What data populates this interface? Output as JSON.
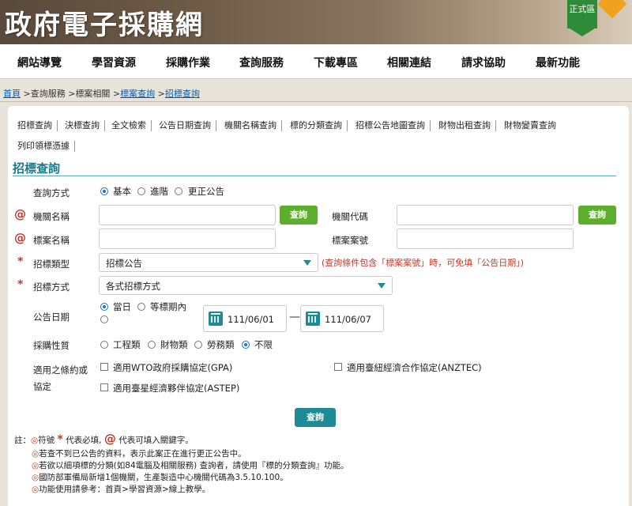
{
  "banner": {
    "title": "政府電子採購網",
    "badge": "正式區"
  },
  "nav": {
    "items": [
      "網站導覽",
      "學習資源",
      "採購作業",
      "查詢服務",
      "下載專區",
      "相關連結",
      "請求協助",
      "最新功能"
    ]
  },
  "breadcrumb": {
    "home": "首頁",
    "query_service": "查詢服務",
    "case_related": "標案相關",
    "case_query": "標案查詢",
    "tender_query": "招標查詢",
    "sep": ">"
  },
  "tabs": [
    "招標查詢",
    "決標查詢",
    "全文檢索",
    "公告日期查詢",
    "機關名稱查詢",
    "標的分類查詢",
    "招標公告地圖查詢",
    "財物出租查詢",
    "財物變賣查詢",
    "列印領標憑據"
  ],
  "section_title": "招標查詢",
  "form": {
    "query_mode": {
      "label": "查詢方式",
      "options": [
        "基本",
        "進階",
        "更正公告"
      ],
      "selected": "基本"
    },
    "org_name": {
      "label": "機關名稱",
      "value": ""
    },
    "org_code": {
      "label": "機關代碼",
      "value": ""
    },
    "case_name": {
      "label": "標案名稱",
      "value": ""
    },
    "case_no": {
      "label": "標案案號",
      "value": ""
    },
    "query_btn": "查詢",
    "tender_type": {
      "label": "招標類型",
      "selected": "招標公告"
    },
    "tender_type_hint": "(查詢條件包含「標案案號」時，可免填「公告日期」)",
    "tender_method": {
      "label": "招標方式",
      "selected": "各式招標方式"
    },
    "announce_date": {
      "label": "公告日期",
      "options": [
        "當日",
        "等標期內"
      ],
      "selected": "當日",
      "from": "111/06/01",
      "to": "111/06/07",
      "range_sep": "—"
    },
    "procurement_nature": {
      "label": "採購性質",
      "options": [
        "工程類",
        "財物類",
        "勞務類",
        "不限"
      ],
      "selected": "不限"
    },
    "treaty": {
      "label_line1": "適用之條約或",
      "label_line2": "協定",
      "options": [
        "適用WTO政府採購協定(GPA)",
        "適用臺紐經濟合作協定(ANZTEC)",
        "適用臺星經濟夥伴協定(ASTEP)"
      ]
    },
    "submit": "查詢"
  },
  "marks": {
    "at": "@",
    "star": "*"
  },
  "notes": {
    "prefix": "註：",
    "line1_a": "符號",
    "line1_b": "代表必填,",
    "line1_c": "代表可填入關鍵字。",
    "lines": [
      "若查不到已公告的資料，表示此案正在進行更正公告中。",
      "若欲以細項標的分類(如84電腦及相關服務) 查詢者，請使用『標的分類查詢』功能。",
      "國防部軍備局新增1個機關，生產製造中心機關代碼為3.5.10.100。",
      "功能使用請參考：首頁>學習資源>線上教學。"
    ],
    "bullet": "◎"
  },
  "colors": {
    "accent": "#1e8a96",
    "green_btn": "#5eae2e",
    "required": "#c0392b",
    "link": "#0b5ba8"
  }
}
